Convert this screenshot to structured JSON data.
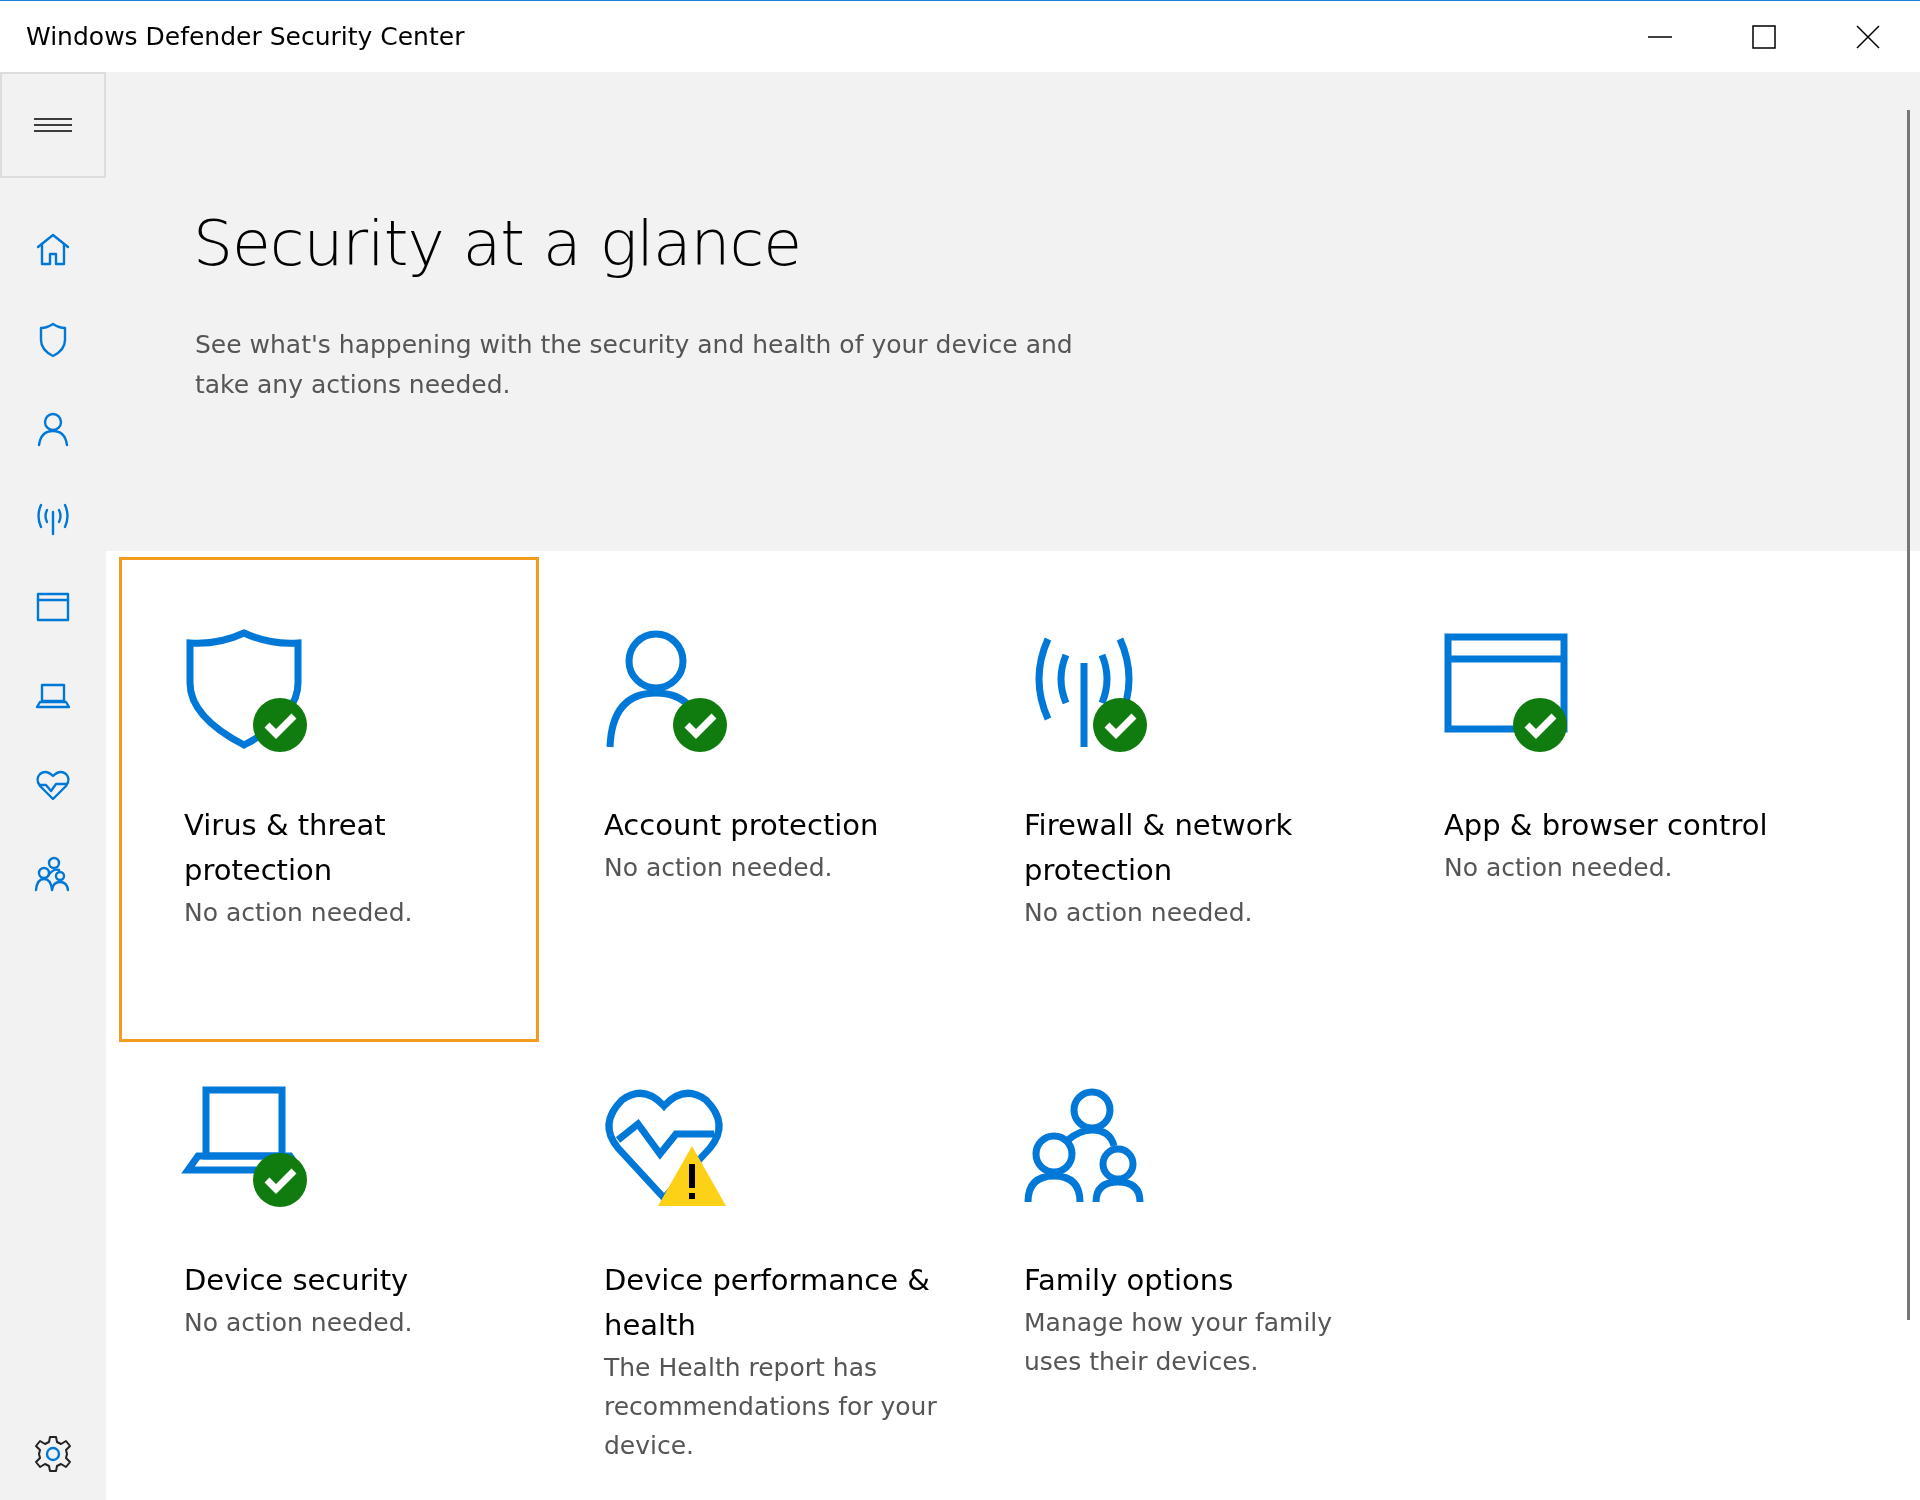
{
  "window": {
    "title": "Windows Defender Security Center"
  },
  "sidebar": {
    "items": [
      {
        "selected": false
      },
      {
        "selected": false
      },
      {
        "selected": false
      },
      {
        "selected": false
      },
      {
        "selected": false
      },
      {
        "selected": false
      },
      {
        "selected": false
      },
      {
        "selected": false
      }
    ]
  },
  "header": {
    "title": "Security at a glance",
    "subtitle": "See what's happening with the security and health of your device and take any actions needed."
  },
  "cards": [
    {
      "kind": "ok",
      "title": "Virus & threat protection",
      "description": "No action needed.",
      "focused": true
    },
    {
      "kind": "ok",
      "title": "Account protection",
      "description": "No action needed.",
      "focused": false
    },
    {
      "kind": "ok",
      "title": "Firewall & network protection",
      "description": "No action needed.",
      "focused": false
    },
    {
      "kind": "ok",
      "title": "App & browser control",
      "description": "No action needed.",
      "focused": false
    },
    {
      "kind": "ok",
      "title": "Device security",
      "description": "No action needed.",
      "focused": false
    },
    {
      "kind": "warning",
      "title": "Device performance & health",
      "description": "The Health report has recommendations for your device.",
      "focused": false
    },
    {
      "kind": "plain",
      "title": "Family options",
      "description": "Manage how your family uses their devices.",
      "focused": false
    }
  ]
}
